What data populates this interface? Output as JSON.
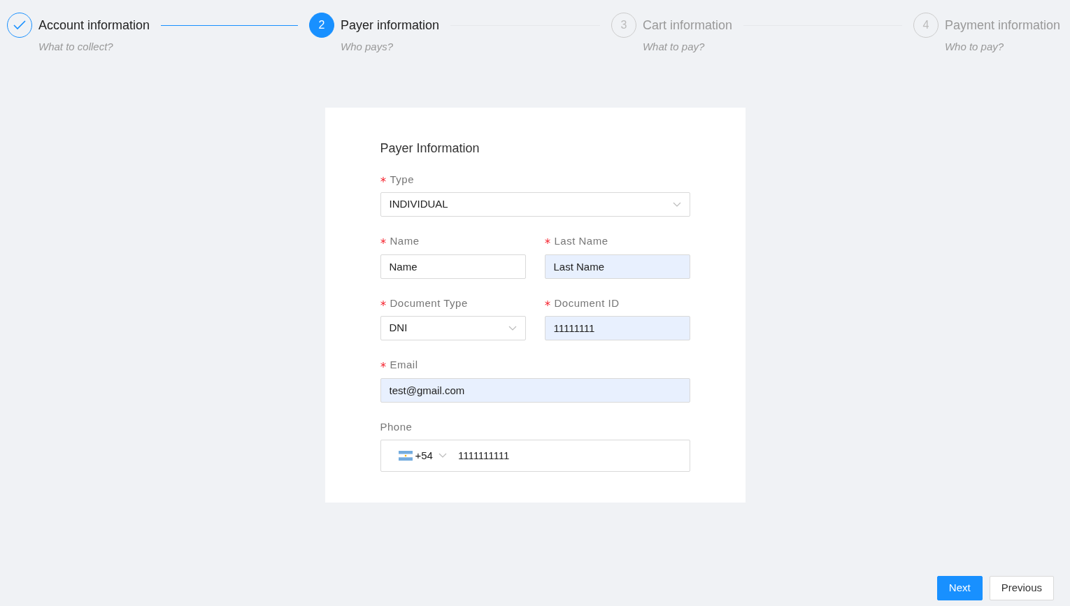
{
  "steps": [
    {
      "title": "Account information",
      "description": "What to collect?",
      "completed": true,
      "selected": false
    },
    {
      "number": "2",
      "title": "Payer information",
      "description": "Who pays?",
      "completed": false,
      "selected": true
    },
    {
      "number": "3",
      "title": "Cart information",
      "description": "What to pay?",
      "completed": false,
      "selected": false
    },
    {
      "number": "4",
      "title": "Payment information",
      "description": "Who to pay?",
      "completed": false,
      "selected": false
    }
  ],
  "form": {
    "title": "Payer Information",
    "rows": [
      [
        {
          "kind": "select",
          "label": "Type",
          "required": true,
          "value": "INDIVIDUAL",
          "autofilled": false
        }
      ],
      [
        {
          "kind": "input",
          "label": "Name",
          "required": true,
          "value": "Name",
          "autofilled": false
        },
        {
          "kind": "input",
          "label": "Last Name",
          "required": true,
          "value": "Last Name",
          "autofilled": true
        }
      ],
      [
        {
          "kind": "select",
          "label": "Document Type",
          "required": true,
          "value": "DNI",
          "autofilled": false
        },
        {
          "kind": "input",
          "label": "Document ID",
          "required": true,
          "value": "11111111",
          "autofilled": true
        }
      ],
      [
        {
          "kind": "input",
          "label": "Email",
          "required": true,
          "value": "test@gmail.com",
          "autofilled": true
        }
      ],
      [
        {
          "kind": "phone",
          "label": "Phone",
          "required": false,
          "country_code": "+54",
          "value": "1111111111",
          "autofilled": false
        }
      ]
    ]
  },
  "buttons": [
    {
      "label": "Next",
      "kind": "primary"
    },
    {
      "label": "Previous",
      "kind": "secondary"
    }
  ]
}
